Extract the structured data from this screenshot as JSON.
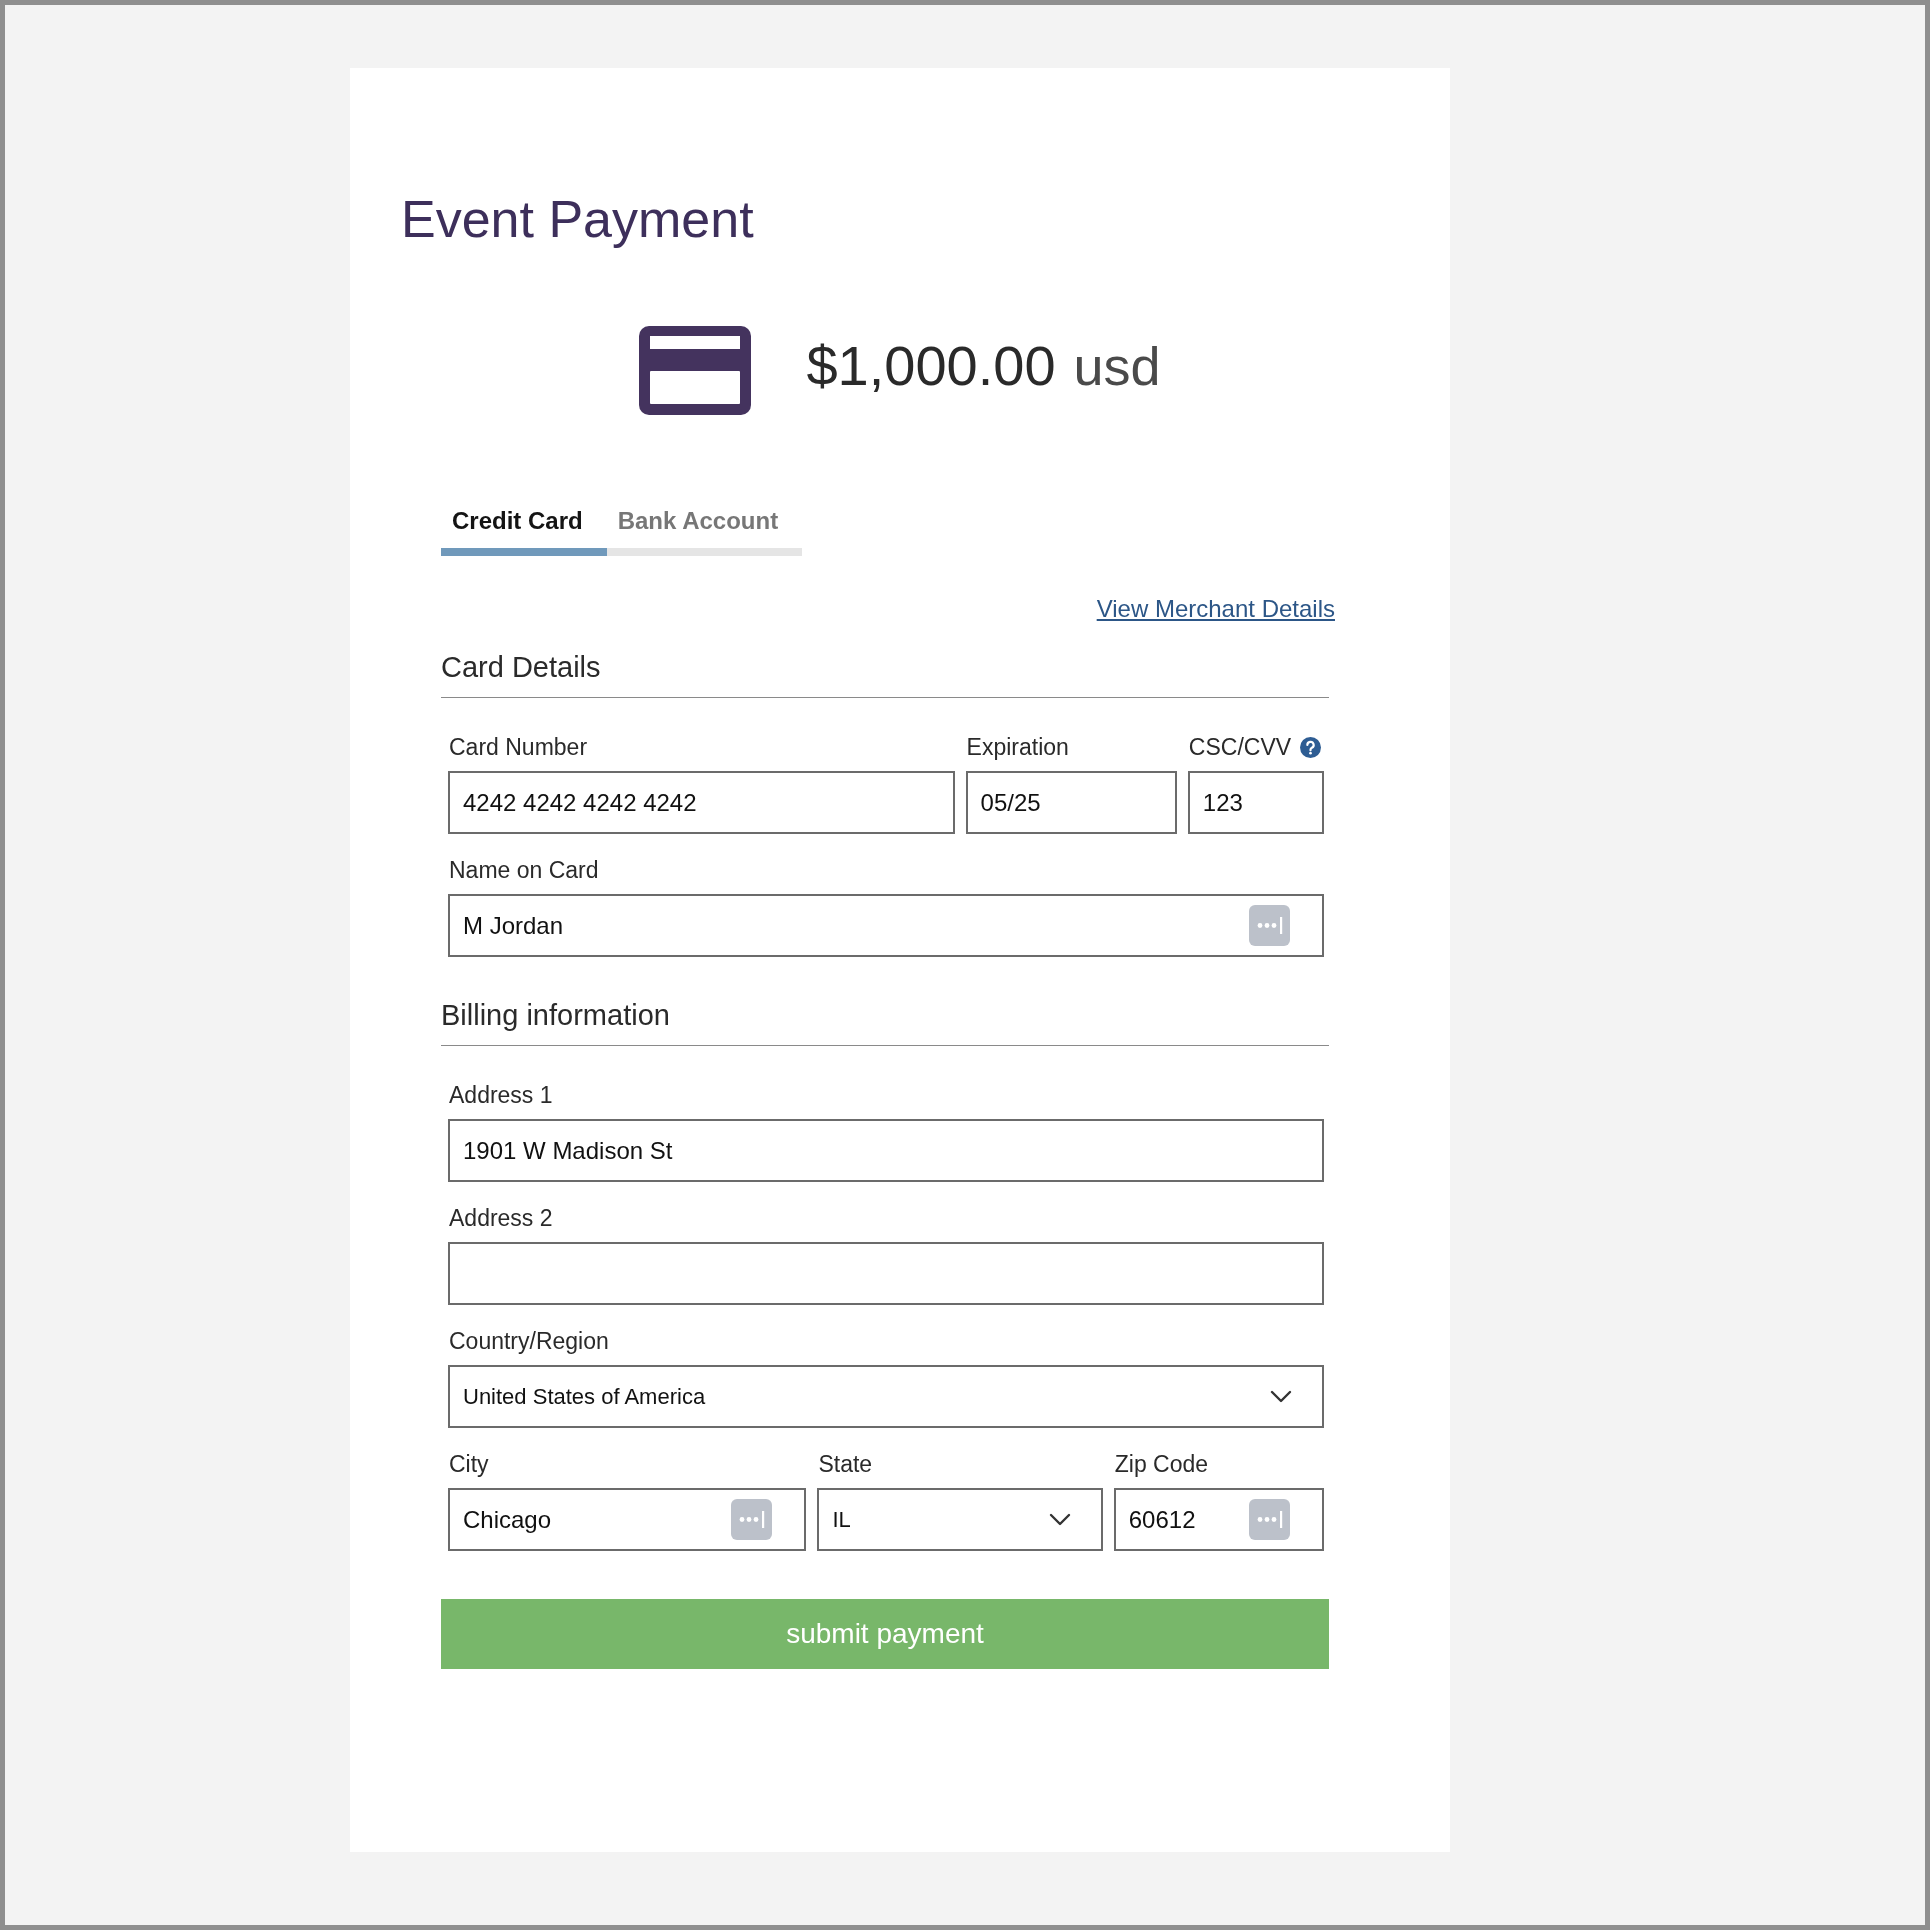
{
  "title": "Event Payment",
  "amount": {
    "value": "$1,000.00",
    "currency": "usd"
  },
  "tabs": [
    {
      "label": "Credit Card",
      "selected": true
    },
    {
      "label": "Bank Account",
      "selected": false
    }
  ],
  "merchant_link": "View Merchant Details",
  "sections": [
    {
      "title": "Card Details",
      "rows": [
        [
          {
            "label": "Card Number",
            "kind": "text",
            "value": "4242 4242 4242 4242",
            "help": false,
            "autofill": false
          },
          {
            "label": "Expiration",
            "kind": "text",
            "value": "05/25",
            "help": false,
            "autofill": false
          },
          {
            "label": "CSC/CVV",
            "kind": "text",
            "value": "123",
            "help": true,
            "autofill": false
          }
        ],
        [
          {
            "label": "Name on Card",
            "kind": "text",
            "value": "M Jordan",
            "help": false,
            "autofill": true
          }
        ]
      ]
    },
    {
      "title": "Billing information",
      "rows": [
        [
          {
            "label": "Address 1",
            "kind": "text",
            "value": "1901 W Madison St",
            "help": false,
            "autofill": false
          }
        ],
        [
          {
            "label": "Address 2",
            "kind": "text",
            "help": false,
            "autofill": false
          }
        ],
        [
          {
            "label": "Country/Region",
            "kind": "select",
            "value": "United States of America",
            "help": false,
            "autofill": false
          }
        ],
        [
          {
            "label": "City",
            "kind": "text",
            "value": "Chicago",
            "help": false,
            "autofill": true
          },
          {
            "label": "State",
            "kind": "select",
            "value": "IL",
            "help": false,
            "autofill": false
          },
          {
            "label": "Zip Code",
            "kind": "text",
            "value": "60612",
            "help": false,
            "autofill": true
          }
        ]
      ]
    }
  ],
  "submit_button": "submit payment"
}
